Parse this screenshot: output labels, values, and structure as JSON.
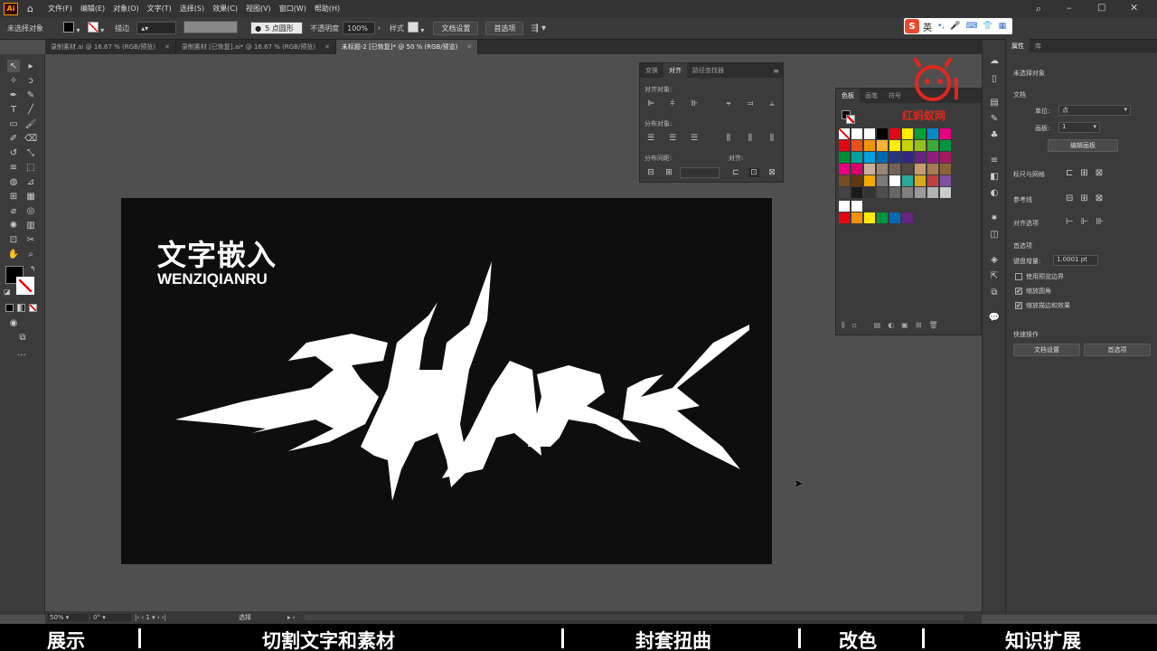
{
  "menubar": {
    "app_logo": "Ai",
    "items": [
      "文件(F)",
      "编辑(E)",
      "对象(O)",
      "文字(T)",
      "选择(S)",
      "效果(C)",
      "视图(V)",
      "窗口(W)",
      "帮助(H)"
    ],
    "right_icons": [
      "search-icon",
      "minimize-icon",
      "maximize-icon",
      "close-icon"
    ]
  },
  "ime": {
    "label": "英"
  },
  "controlbar": {
    "selection_label": "未选择对象",
    "stroke_label": "描边",
    "brush": "5 点圆形",
    "opacity_label": "不透明度",
    "opacity_value": "100%",
    "style_label": "样式",
    "doc_setup": "文档设置",
    "prefs": "首选项"
  },
  "tabs": [
    {
      "label": "录制素材.ai @ 16.67 % (RGB/预览)",
      "active": false
    },
    {
      "label": "录制素材 [已恢复].ai* @ 16.67 % (RGB/预览)",
      "active": false
    },
    {
      "label": "未标题-2 [已恢复]* @ 50 % (RGB/预览)",
      "active": true
    }
  ],
  "artboard": {
    "title": "文字嵌入",
    "subtitle": "WENZIQIANRU",
    "art_text": "SHARK"
  },
  "align_panel": {
    "tabs": [
      "变换",
      "对齐",
      "路径查找器"
    ],
    "active_tab": 1,
    "align_objects": "对齐对象:",
    "distribute_objects": "分布对象:",
    "distribute_spacing": "分布间距:",
    "align_to": "对齐:"
  },
  "swatches_panel": {
    "tabs": [
      "色板",
      "画笔",
      "符号"
    ],
    "active_tab": 0,
    "rows": [
      [
        "none",
        "#ffffff",
        "#ffffff",
        "#000000",
        "#e30613",
        "#ffec00",
        "#00a13a",
        "#0089c7",
        "#e5007f"
      ],
      [
        "#e30613",
        "#e94e1b",
        "#f39200",
        "#f9b233",
        "#ffec00",
        "#c8d400",
        "#95c11f",
        "#3aaa35",
        "#009640"
      ],
      [
        "#008d36",
        "#00a19a",
        "#009fe3",
        "#0069b4",
        "#283583",
        "#312783",
        "#662483",
        "#951b81",
        "#a3195b"
      ],
      [
        "#e6007e",
        "#d6006e",
        "#c7b299",
        "#998675",
        "#736357",
        "#534741",
        "#c69c6d",
        "#a67c52",
        "#8c6239"
      ],
      [
        "#754c24",
        "#603813",
        "#f2a900",
        "#7a7a7a",
        "#ffffff",
        "#2aa89a",
        "#d9a71c",
        "#c04040",
        "#8050a0"
      ],
      [
        "#444444",
        "#1a1a1a",
        "#333333",
        "#4d4d4d",
        "#666666",
        "#808080",
        "#999999",
        "#b3b3b3",
        "#cccccc"
      ],
      [
        "#ffffff",
        "#ffffff"
      ],
      [
        "#e30613",
        "#f39200",
        "#ffec00",
        "#009640",
        "#0069b4",
        "#662483"
      ]
    ]
  },
  "properties": {
    "tabs": [
      "属性",
      "库"
    ],
    "no_selection": "未选择对象",
    "document": "文档",
    "units_label": "单位:",
    "units_value": "点",
    "artboard_label": "画板:",
    "artboard_value": "1",
    "edit_artboards": "编辑画板",
    "rulers_grids": "标尺与网格",
    "guides": "参考线",
    "snap_options": "对齐选项",
    "preferences": "首选项",
    "keyboard_increment_label": "键盘增量:",
    "keyboard_increment_value": "1.0001 pt",
    "use_preview_bounds": "使用预览边界",
    "scale_corners": "缩放圆角",
    "scale_strokes": "缩放描边和效果",
    "quick_actions": "快速操作",
    "doc_setup": "文档设置",
    "prefs": "首选项",
    "checks": {
      "use_preview_bounds": false,
      "scale_corners": true,
      "scale_strokes": true
    }
  },
  "statusbar": {
    "zoom": "50%",
    "rotation": "0°",
    "artboard": "1",
    "tool": "选择"
  },
  "watermark": {
    "text": "红蚂蚁网"
  },
  "caption": {
    "items": [
      "展示",
      "切割文字和素材",
      "封套扭曲",
      "改色",
      "知识扩展"
    ]
  },
  "colors": {
    "accent": "#e84a2e",
    "watermark": "#e0281c"
  }
}
